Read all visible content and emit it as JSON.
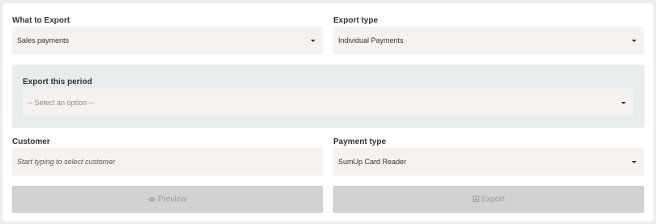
{
  "what_to_export": {
    "label": "What to Export",
    "value": "Sales payments"
  },
  "export_type": {
    "label": "Export type",
    "value": "Individual Payments"
  },
  "period": {
    "label": "Export this period",
    "placeholder": "-- Select an option --"
  },
  "customer": {
    "label": "Customer",
    "placeholder": "Start typing to select customer"
  },
  "payment_type": {
    "label": "Payment type",
    "value": "SumUp Card Reader"
  },
  "actions": {
    "preview_label": "Preview",
    "preview_icon": "eye-icon",
    "export_label": "Export",
    "export_icon": "export-icon"
  },
  "colors": {
    "field_bg": "#f5f1ee",
    "period_bg": "#e6edec",
    "button_disabled_bg": "#d2d2d2"
  }
}
